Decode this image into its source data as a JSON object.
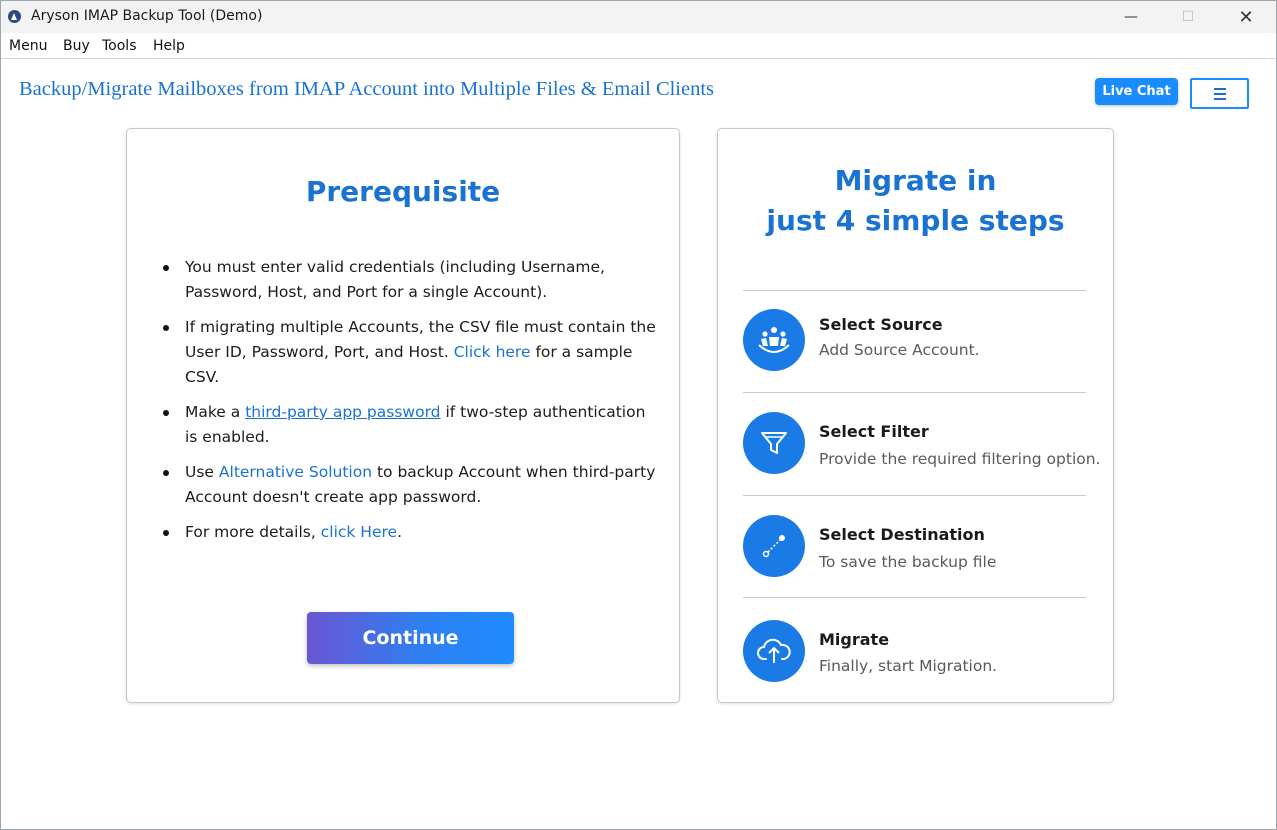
{
  "window": {
    "title": "Aryson IMAP Backup Tool (Demo)",
    "minimize": "—",
    "maximize": "☐",
    "close": "✕"
  },
  "menu": [
    "Menu",
    "Buy",
    "Tools",
    "Help"
  ],
  "header": {
    "title": "Backup/Migrate Mailboxes from IMAP Account into Multiple Files & Email Clients",
    "live_chat": "Live Chat"
  },
  "prerequisite": {
    "title": "Prerequisite",
    "bullets": [
      {
        "text": "You must enter valid credentials (including Username, Password, Host, and Port for a single Account)."
      },
      {
        "text_before": "If migrating multiple Accounts, the CSV file must contain the User ID, Password, Port, and Host.",
        "link": "Click here",
        "text_after": "for a sample CSV."
      },
      {
        "text_before": "Make a",
        "link": "third-party app password",
        "text_after": "if two-step authentication is enabled."
      },
      {
        "text_before": "Use",
        "link": "Alternative Solution",
        "text_after": "to backup Account when third-party Account doesn't create app password."
      },
      {
        "text_before": "For more details,",
        "link": "click Here",
        "text_after": "."
      }
    ],
    "continue_label": "Continue"
  },
  "steps": {
    "title_line1": "Migrate in",
    "title_line2": "just 4 simple steps",
    "items": [
      {
        "title": "Select Source",
        "desc": "Add Source Account.",
        "icon": "users-icon"
      },
      {
        "title": "Select Filter",
        "desc": "Provide the required filtering option.",
        "icon": "filter-icon"
      },
      {
        "title": "Select Destination",
        "desc": "To save the backup file",
        "icon": "path-icon"
      },
      {
        "title": "Migrate",
        "desc": "Finally, start Migration.",
        "icon": "cloud-upload-icon"
      }
    ]
  },
  "colors": {
    "accent": "#1a73d0",
    "button": "#1a8cff",
    "icon_bg": "#1a7be6"
  }
}
